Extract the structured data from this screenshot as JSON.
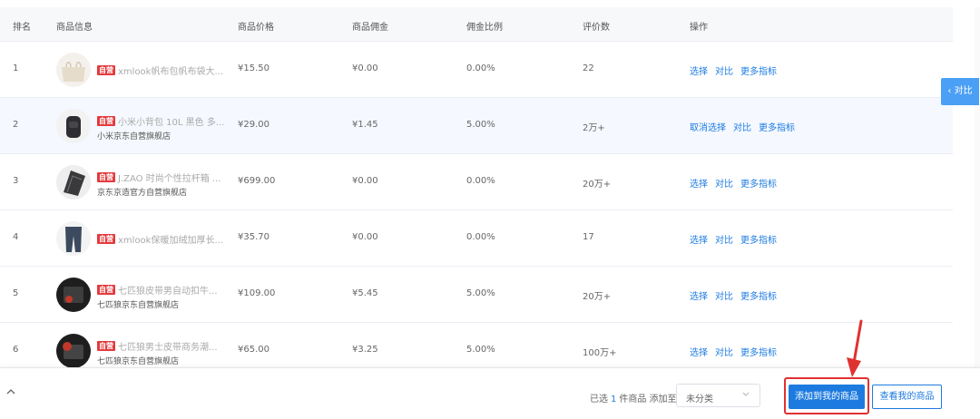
{
  "table": {
    "headers": [
      "排名",
      "商品信息",
      "商品价格",
      "商品佣金",
      "佣金比例",
      "评价数",
      "操作"
    ],
    "rows": [
      {
        "rank": "1",
        "tag": "自营",
        "name": "xmlook帆布包帆布袋大...",
        "shop": "",
        "price": "¥15.50",
        "commission": "¥0.00",
        "rate": "0.00%",
        "reviews": "22",
        "ops": [
          "选择",
          "对比",
          "更多指标"
        ]
      },
      {
        "rank": "2",
        "tag": "自营",
        "name": "小米小背包 10L 黑色 多...",
        "shop": "小米京东自营旗舰店",
        "price": "¥29.00",
        "commission": "¥1.45",
        "rate": "5.00%",
        "reviews": "2万+",
        "ops": [
          "取消选择",
          "对比",
          "更多指标"
        ]
      },
      {
        "rank": "3",
        "tag": "自营",
        "name": "J.ZAO 时尚个性拉杆箱 ...",
        "shop": "京东京造官方自营旗舰店",
        "price": "¥699.00",
        "commission": "¥0.00",
        "rate": "0.00%",
        "reviews": "20万+",
        "ops": [
          "选择",
          "对比",
          "更多指标"
        ]
      },
      {
        "rank": "4",
        "tag": "自营",
        "name": "xmlook保暖加绒加厚长...",
        "shop": "",
        "price": "¥35.70",
        "commission": "¥0.00",
        "rate": "0.00%",
        "reviews": "17",
        "ops": [
          "选择",
          "对比",
          "更多指标"
        ]
      },
      {
        "rank": "5",
        "tag": "自营",
        "name": "七匹狼皮带男自动扣牛...",
        "shop": "七匹狼京东自营旗舰店",
        "price": "¥109.00",
        "commission": "¥5.45",
        "rate": "5.00%",
        "reviews": "20万+",
        "ops": [
          "选择",
          "对比",
          "更多指标"
        ]
      },
      {
        "rank": "6",
        "tag": "自营",
        "name": "七匹狼男士皮带商务潮...",
        "shop": "七匹狼京东自营旗舰店",
        "price": "¥65.00",
        "commission": "¥3.25",
        "rate": "5.00%",
        "reviews": "100万+",
        "ops": [
          "选择",
          "对比",
          "更多指标"
        ]
      }
    ]
  },
  "side_tab": {
    "label": "对比",
    "icon": "chevron-left-icon"
  },
  "footer": {
    "selected_prefix": "已选",
    "selected_count": "1",
    "selected_suffix": "件商品 添加至",
    "category_value": "未分类",
    "add_button": "添加到我的商品",
    "view_button": "查看我的商品",
    "collapse_icon": "chevron-up-icon"
  },
  "colors": {
    "accent": "#1d7be0",
    "tag_red": "#e4393c",
    "highlight_row": "#f5f9ff",
    "annotation_red": "#e03131"
  }
}
